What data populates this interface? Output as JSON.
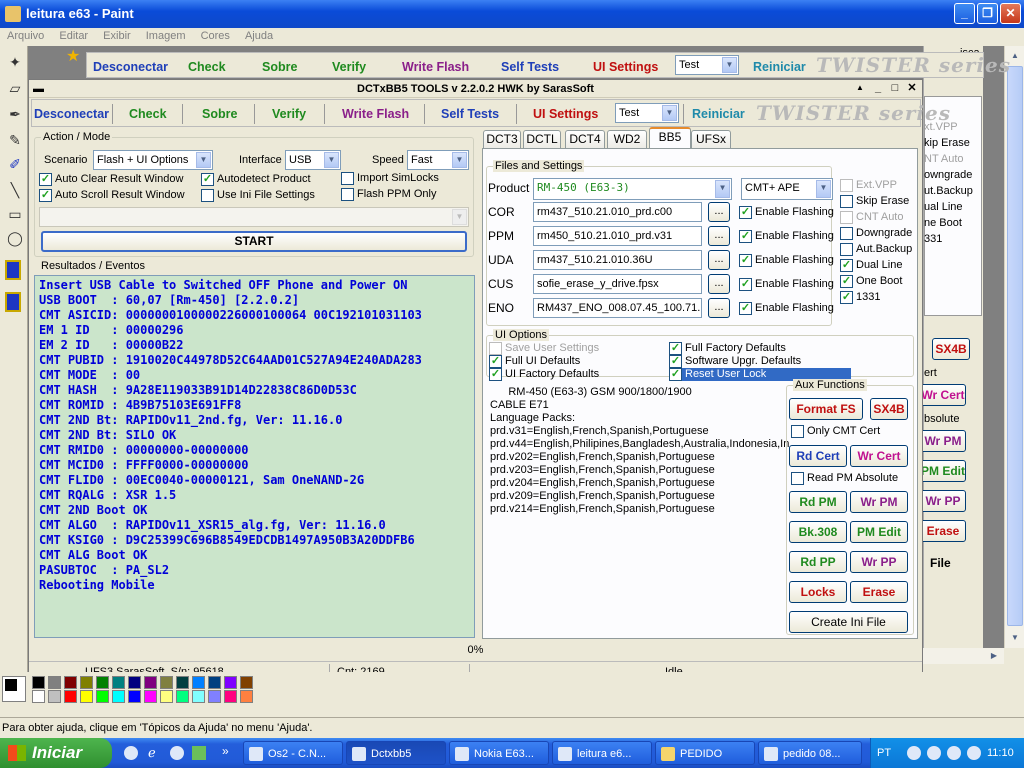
{
  "paint": {
    "title": "leitura e63 - Paint",
    "menu": [
      "Arquivo",
      "Editar",
      "Exibir",
      "Imagem",
      "Cores",
      "Ajuda"
    ],
    "status": "Para obter ajuda, clique em 'Tópicos da Ajuda' no menu 'Ajuda'.",
    "right_fragments": [
      "isca",
      "xt.VPP",
      "kip Erase",
      "NT Auto",
      "owngrade",
      "ut.Backup",
      "ual Line",
      "ne Boot",
      "331",
      "ert",
      "bsolute",
      "File"
    ]
  },
  "app": {
    "title": "DCTxBB5 TOOLS v 2.2.0.2 HWK by SarasSoft",
    "toolbar": {
      "disconnect": "Desconectar",
      "check": "Check",
      "about": "Sobre",
      "verify": "Verify",
      "write_flash": "Write Flash",
      "self_tests": "Self Tests",
      "ui_settings": "UI Settings",
      "mode_select": "Test",
      "restart": "Reiniciar",
      "brand": "TWISTER series"
    },
    "action": {
      "group_label": "Action / Mode",
      "scenario_label": "Scenario",
      "scenario_value": "Flash + UI Options",
      "interface_label": "Interface",
      "interface_value": "USB",
      "speed_label": "Speed",
      "speed_value": "Fast",
      "checks": [
        {
          "label": "Auto Clear Result Window",
          "checked": true
        },
        {
          "label": "Auto Scroll Result Window",
          "checked": true
        },
        {
          "label": "Autodetect Product",
          "checked": true
        },
        {
          "label": "Use Ini File Settings",
          "checked": false
        },
        {
          "label": "Import SimLocks",
          "checked": false
        },
        {
          "label": "Flash PPM Only",
          "checked": false
        }
      ],
      "start": "START"
    },
    "results": {
      "label": "Resultados / Eventos",
      "lines": [
        "Insert USB Cable to Switched OFF Phone and Power ON",
        "USB BOOT  : 60,07 [Rm-450] [2.2.0.2]",
        "CMT ASICID: 0000000100000226000100064 00C192101031103",
        "EM 1 ID   : 00000296",
        "EM 2 ID   : 00000B22",
        "CMT PUBID : 1910020C44978D52C64AAD01C527A94E240ADA283",
        "CMT MODE  : 00",
        "CMT HASH  : 9A28E119033B91D14D22838C86D0D53C",
        "CMT ROMID : 4B9B75103E691FF8",
        "CMT 2ND Bt: RAPIDOv11_2nd.fg, Ver: 11.16.0",
        "CMT 2ND Bt: SILO OK",
        "CMT RMID0 : 00000000-00000000",
        "CMT MCID0 : FFFF0000-00000000",
        "CMT FLID0 : 00EC0040-00000121, Sam OneNAND-2G",
        "CMT RQALG : XSR 1.5",
        "CMT 2ND Boot OK",
        "CMT ALGO  : RAPIDOv11_XSR15_alg.fg, Ver: 11.16.0",
        "CMT KSIG0 : D9C25399C696B8549EDCDB1497A950B3A20DDFB6",
        "CMT ALG Boot OK",
        "PASUBTOC  : PA_SL2",
        "Rebooting Mobile"
      ]
    },
    "tabs": [
      "DCT3",
      "DCTL",
      "DCT4",
      "WD2",
      "BB5",
      "UFSx"
    ],
    "files": {
      "group_label": "Files and Settings",
      "product_label": "Product",
      "product_value": "RM-450  (E63-3)",
      "product_mode": "CMT+ APE",
      "rows": [
        {
          "label": "COR",
          "value": "rm437_510.21.010_prd.c00",
          "flash": "Enable Flashing"
        },
        {
          "label": "PPM",
          "value": "rm450_510.21.010_prd.v31",
          "flash": "Enable Flashing"
        },
        {
          "label": "UDA",
          "value": "rm437_510.21.010.36U",
          "flash": "Enable Flashing"
        },
        {
          "label": "CUS",
          "value": "sofie_erase_y_drive.fpsx",
          "flash": "Enable Flashing"
        },
        {
          "label": "ENO",
          "value": "RM437_ENO_008.07.45_100.71.",
          "flash": "Enable Flashing"
        }
      ],
      "browse": "...",
      "side_checks": [
        {
          "label": "Ext.VPP",
          "checked": false,
          "disabled": true
        },
        {
          "label": "Skip Erase",
          "checked": false,
          "disabled": false
        },
        {
          "label": "CNT Auto",
          "checked": false,
          "disabled": true
        },
        {
          "label": "Downgrade",
          "checked": false,
          "disabled": false
        },
        {
          "label": "Aut.Backup",
          "checked": false,
          "disabled": false
        },
        {
          "label": "Dual Line",
          "checked": true,
          "disabled": false
        },
        {
          "label": "One Boot",
          "checked": true,
          "disabled": false
        },
        {
          "label": "1331",
          "checked": true,
          "disabled": false
        }
      ]
    },
    "ui_options": {
      "group_label": "UI Options",
      "checks": [
        {
          "label": "Save User Settings",
          "checked": false,
          "disabled": true
        },
        {
          "label": "Full UI Defaults",
          "checked": true,
          "disabled": false
        },
        {
          "label": "UI Factory Defaults",
          "checked": true,
          "disabled": false
        },
        {
          "label": "Full Factory Defaults",
          "checked": true,
          "disabled": false
        },
        {
          "label": "Software Upgr. Defaults",
          "checked": true,
          "disabled": false
        },
        {
          "label": "Reset User Lock",
          "checked": true,
          "disabled": false
        }
      ]
    },
    "info_lines": [
      "      RM-450 (E63-3) GSM 900/1800/1900",
      "CABLE E71",
      "Language Packs:",
      "prd.v31=English,French,Spanish,Portuguese",
      "prd.v44=English,Philipines,Bangladesh,Australia,Indonesia,In",
      "prd.v202=English,French,Spanish,Portuguese",
      "prd.v203=English,French,Spanish,Portuguese",
      "prd.v204=English,French,Spanish,Portuguese",
      "prd.v209=English,French,Spanish,Portuguese",
      "prd.v214=English,French,Spanish,Portuguese"
    ],
    "aux": {
      "group_label": "Aux Functions",
      "format_fs": "Format FS",
      "sx4b": "SX4B",
      "only_cmt_cert": "Only CMT Cert",
      "rd_cert": "Rd Cert",
      "wr_cert": "Wr Cert",
      "read_pm_absolute": "Read PM Absolute",
      "rd_pm": "Rd PM",
      "wr_pm": "Wr PM",
      "bk308": "Bk.308",
      "pm_edit": "PM Edit",
      "rd_pp": "Rd PP",
      "wr_pp": "Wr PP",
      "locks": "Locks",
      "erase": "Erase",
      "create_ini": "Create Ini File"
    },
    "progress": "0%",
    "status": {
      "serial": "UFS3 SarasSoft, S/n: 95618",
      "count": "Cnt: 2169",
      "state": "Idle"
    }
  },
  "taskbar": {
    "start": "Iniciar",
    "tasks": [
      "Os2 - C.N...",
      "Dctxbb5",
      "Nokia E63...",
      "leitura e6...",
      "PEDIDO",
      "pedido 08..."
    ],
    "lang": "PT",
    "clock": "11:10"
  },
  "colors": {
    "accent_blue": "#0a4bd8",
    "log_bg": "#cbe5cb",
    "log_text": "#0000d8",
    "tb_green": "#1f8a1f",
    "tb_blue": "#1f3fb8",
    "tb_purple": "#8a1f8a",
    "tb_red": "#c01010"
  }
}
